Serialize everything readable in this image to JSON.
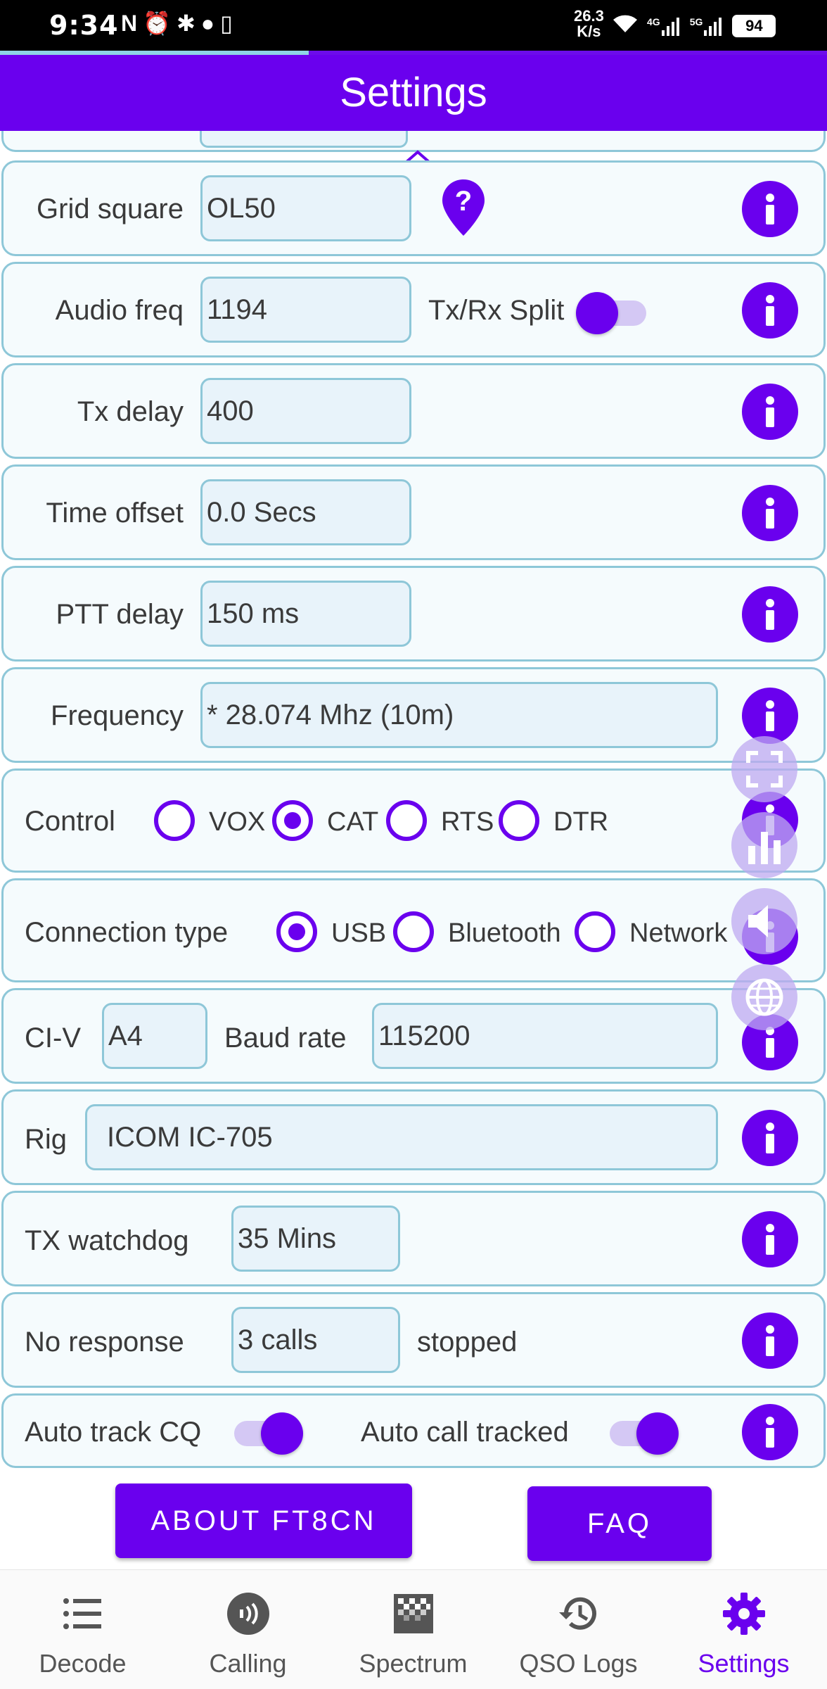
{
  "status_bar": {
    "time": "9:34",
    "speed_value": "26.3",
    "speed_unit": "K/s",
    "battery": "94",
    "net_1": "4G",
    "net_2": "5G"
  },
  "app_bar": {
    "title": "Settings",
    "progress_fraction": 0.373
  },
  "rows": {
    "grid_square": {
      "label": "Grid square",
      "value": "OL50"
    },
    "audio_freq": {
      "label": "Audio freq",
      "value": "1194",
      "split_label": "Tx/Rx Split",
      "split_on": false
    },
    "tx_delay": {
      "label": "Tx delay",
      "value": "400"
    },
    "time_offset": {
      "label": "Time offset",
      "value": "0.0 Secs"
    },
    "ptt_delay": {
      "label": "PTT delay",
      "value": "150 ms"
    },
    "frequency": {
      "label": "Frequency",
      "value": "* 28.074 Mhz (10m)"
    },
    "control": {
      "label": "Control",
      "options": [
        "VOX",
        "CAT",
        "RTS",
        "DTR"
      ],
      "selected": "CAT"
    },
    "connection_type": {
      "label": "Connection type",
      "options": [
        "USB",
        "Bluetooth",
        "Network"
      ],
      "selected": "USB"
    },
    "civ": {
      "label": "CI-V",
      "value": "A4",
      "baud_label": "Baud rate",
      "baud_value": "115200"
    },
    "rig": {
      "label": "Rig",
      "value": "ICOM IC-705"
    },
    "tx_watchdog": {
      "label": "TX watchdog",
      "value": "35 Mins"
    },
    "no_response": {
      "label": "No response",
      "value": "3 calls",
      "suffix": "stopped"
    },
    "auto_track": {
      "label": "Auto track CQ",
      "on": true,
      "call_label": "Auto call tracked",
      "call_on": true
    }
  },
  "buttons": {
    "about": "ABOUT FT8CN",
    "faq": "FAQ"
  },
  "bottom_nav": {
    "items": [
      {
        "label": "Decode",
        "icon": "list-icon"
      },
      {
        "label": "Calling",
        "icon": "calling-icon"
      },
      {
        "label": "Spectrum",
        "icon": "spectrum-icon"
      },
      {
        "label": "QSO Logs",
        "icon": "history-icon"
      },
      {
        "label": "Settings",
        "icon": "gear-icon"
      }
    ],
    "active": "Settings"
  },
  "colors": {
    "accent": "#6a00ee",
    "border": "#8ec7d8",
    "card_bg": "#f5fbfd",
    "field_bg": "#e8f3fa"
  }
}
